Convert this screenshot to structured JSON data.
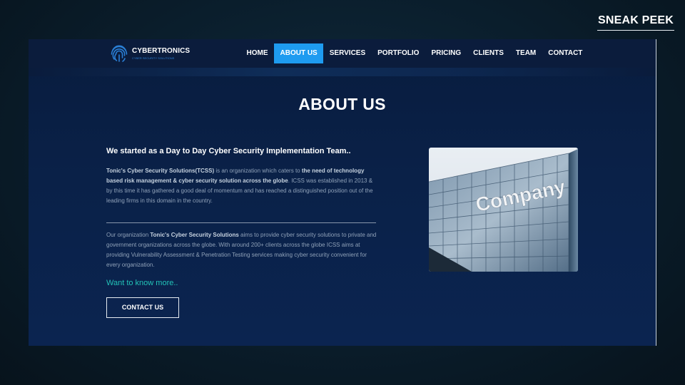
{
  "badge": "SNEAK PEEK",
  "brand": {
    "name": "CYBERTRONICS",
    "tagline": "CYBER SECURITY SOLUTIONS",
    "color": "#2a7fd6"
  },
  "nav": {
    "items": [
      {
        "label": "HOME"
      },
      {
        "label": "ABOUT US",
        "active": true
      },
      {
        "label": "SERVICES"
      },
      {
        "label": "PORTFOLIO"
      },
      {
        "label": "PRICING"
      },
      {
        "label": "CLIENTS"
      },
      {
        "label": "TEAM"
      },
      {
        "label": "CONTACT"
      }
    ],
    "active_color": "#1e9bf0"
  },
  "about": {
    "title": "ABOUT US",
    "heading": "We started as a Day to Day Cyber Security Implementation Team..",
    "para1": {
      "bold1": "Tonic's Cyber Security Solutions(TCSS)",
      "text1": " is an organization which caters to ",
      "bold2": "the need of technology based risk management & cyber security solution across the globe",
      "text2": ". ICSS was established in 2013 & by this time it has gathered a good deal of momentum and has reached a distinguished position out of the leading firms in this domain in the country."
    },
    "para2": {
      "text1": "Our organization ",
      "bold1": "Tonic's Cyber Security Solutions",
      "text2": " aims to provide cyber security solutions to private and government organizations across the globe. With around 200+ clients across the globe ICSS aims at providing Vulnerability Assessment & Penetration Testing services making cyber security convenient for every organization."
    },
    "link_text": "Want to know more..",
    "link_color": "#22c3b7",
    "button_label": "CONTACT US",
    "image_text": "Company"
  }
}
